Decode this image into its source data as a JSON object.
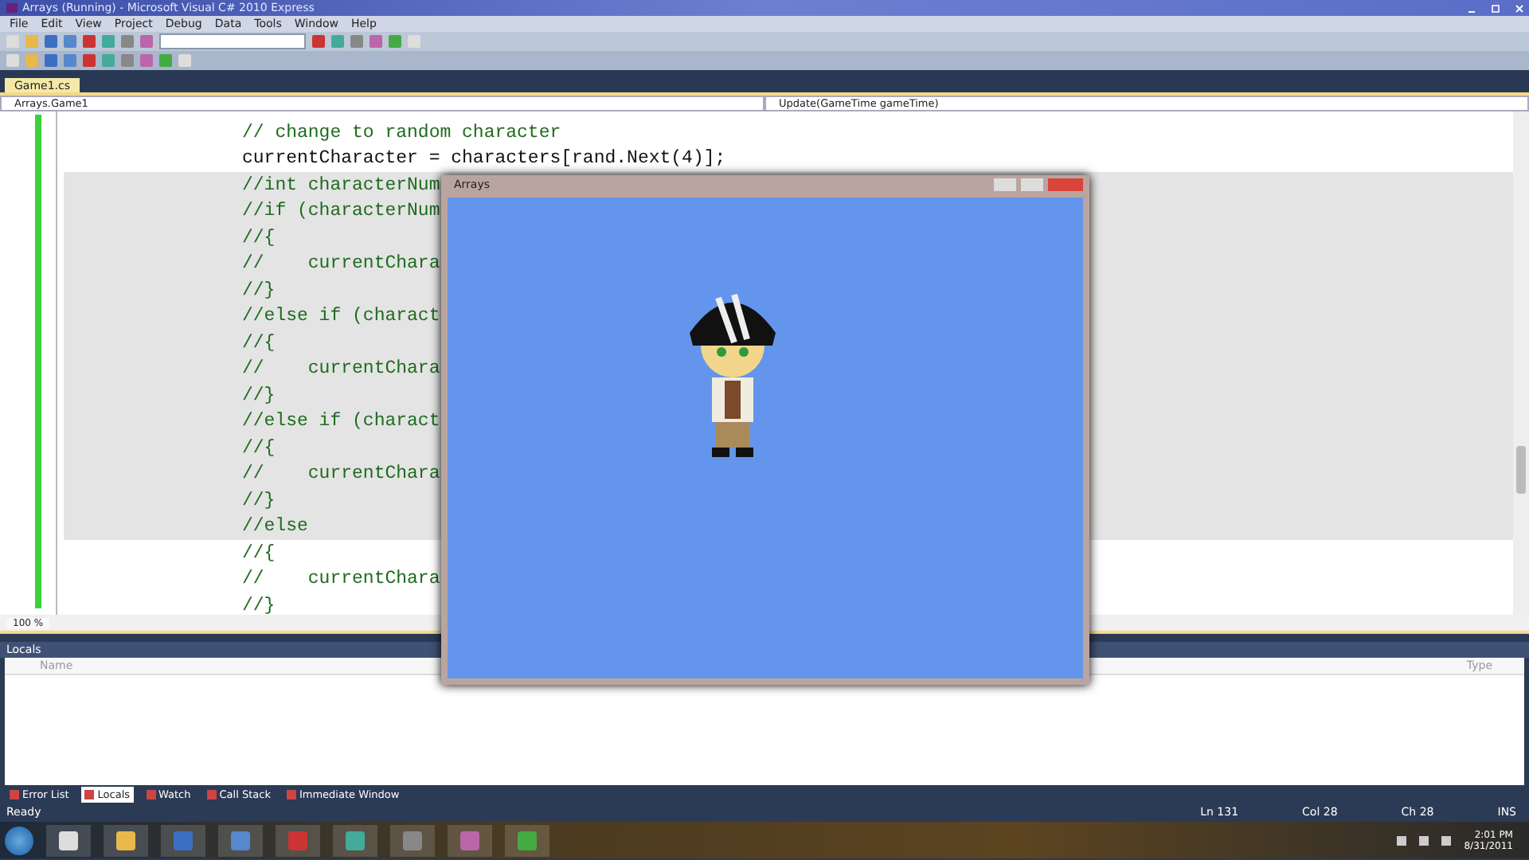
{
  "window": {
    "title": "Arrays (Running) - Microsoft Visual C# 2010 Express"
  },
  "menu": [
    "File",
    "Edit",
    "View",
    "Project",
    "Debug",
    "Data",
    "Tools",
    "Window",
    "Help"
  ],
  "document_tabs": [
    {
      "label": "Game1.cs",
      "selected": true
    }
  ],
  "type_dropdown": "Arrays.Game1",
  "member_dropdown": "Update(GameTime gameTime)",
  "code_lines": [
    {
      "text": "// change to random character",
      "kind": "comment",
      "highlighted": false
    },
    {
      "text": "currentCharacter = characters[rand.Next(4)];",
      "kind": "code",
      "highlighted": false
    },
    {
      "text": "//int characterNum",
      "kind": "comment",
      "highlighted": true
    },
    {
      "text": "//if (characterNum",
      "kind": "comment",
      "highlighted": true
    },
    {
      "text": "//{",
      "kind": "comment",
      "highlighted": true
    },
    {
      "text": "//    currentChara",
      "kind": "comment",
      "highlighted": true
    },
    {
      "text": "//}",
      "kind": "comment",
      "highlighted": true
    },
    {
      "text": "//else if (charact",
      "kind": "comment",
      "highlighted": true
    },
    {
      "text": "//{",
      "kind": "comment",
      "highlighted": true
    },
    {
      "text": "//    currentChara",
      "kind": "comment",
      "highlighted": true
    },
    {
      "text": "//}",
      "kind": "comment",
      "highlighted": true
    },
    {
      "text": "//else if (charact",
      "kind": "comment",
      "highlighted": true
    },
    {
      "text": "//{",
      "kind": "comment",
      "highlighted": true
    },
    {
      "text": "//    currentChara",
      "kind": "comment",
      "highlighted": true
    },
    {
      "text": "//}",
      "kind": "comment",
      "highlighted": true
    },
    {
      "text": "//else",
      "kind": "comment",
      "highlighted": true
    },
    {
      "text": "//{",
      "kind": "comment",
      "highlighted": false
    },
    {
      "text": "//    currentChara",
      "kind": "comment",
      "highlighted": false
    },
    {
      "text": "//}",
      "kind": "comment",
      "highlighted": false
    }
  ],
  "zoom": "100 %",
  "game_window": {
    "title": "Arrays"
  },
  "locals": {
    "title": "Locals",
    "columns": [
      "Name",
      "Type"
    ]
  },
  "panel_tabs": [
    {
      "label": "Error List",
      "selected": false
    },
    {
      "label": "Locals",
      "selected": true
    },
    {
      "label": "Watch",
      "selected": false
    },
    {
      "label": "Call Stack",
      "selected": false
    },
    {
      "label": "Immediate Window",
      "selected": false
    }
  ],
  "status_bar": {
    "text": "Ready",
    "line": "Ln 131",
    "col": "Col 28",
    "ch": "Ch 28",
    "mode": "INS"
  },
  "taskbar": {
    "time": "2:01 PM",
    "date": "8/31/2011"
  }
}
